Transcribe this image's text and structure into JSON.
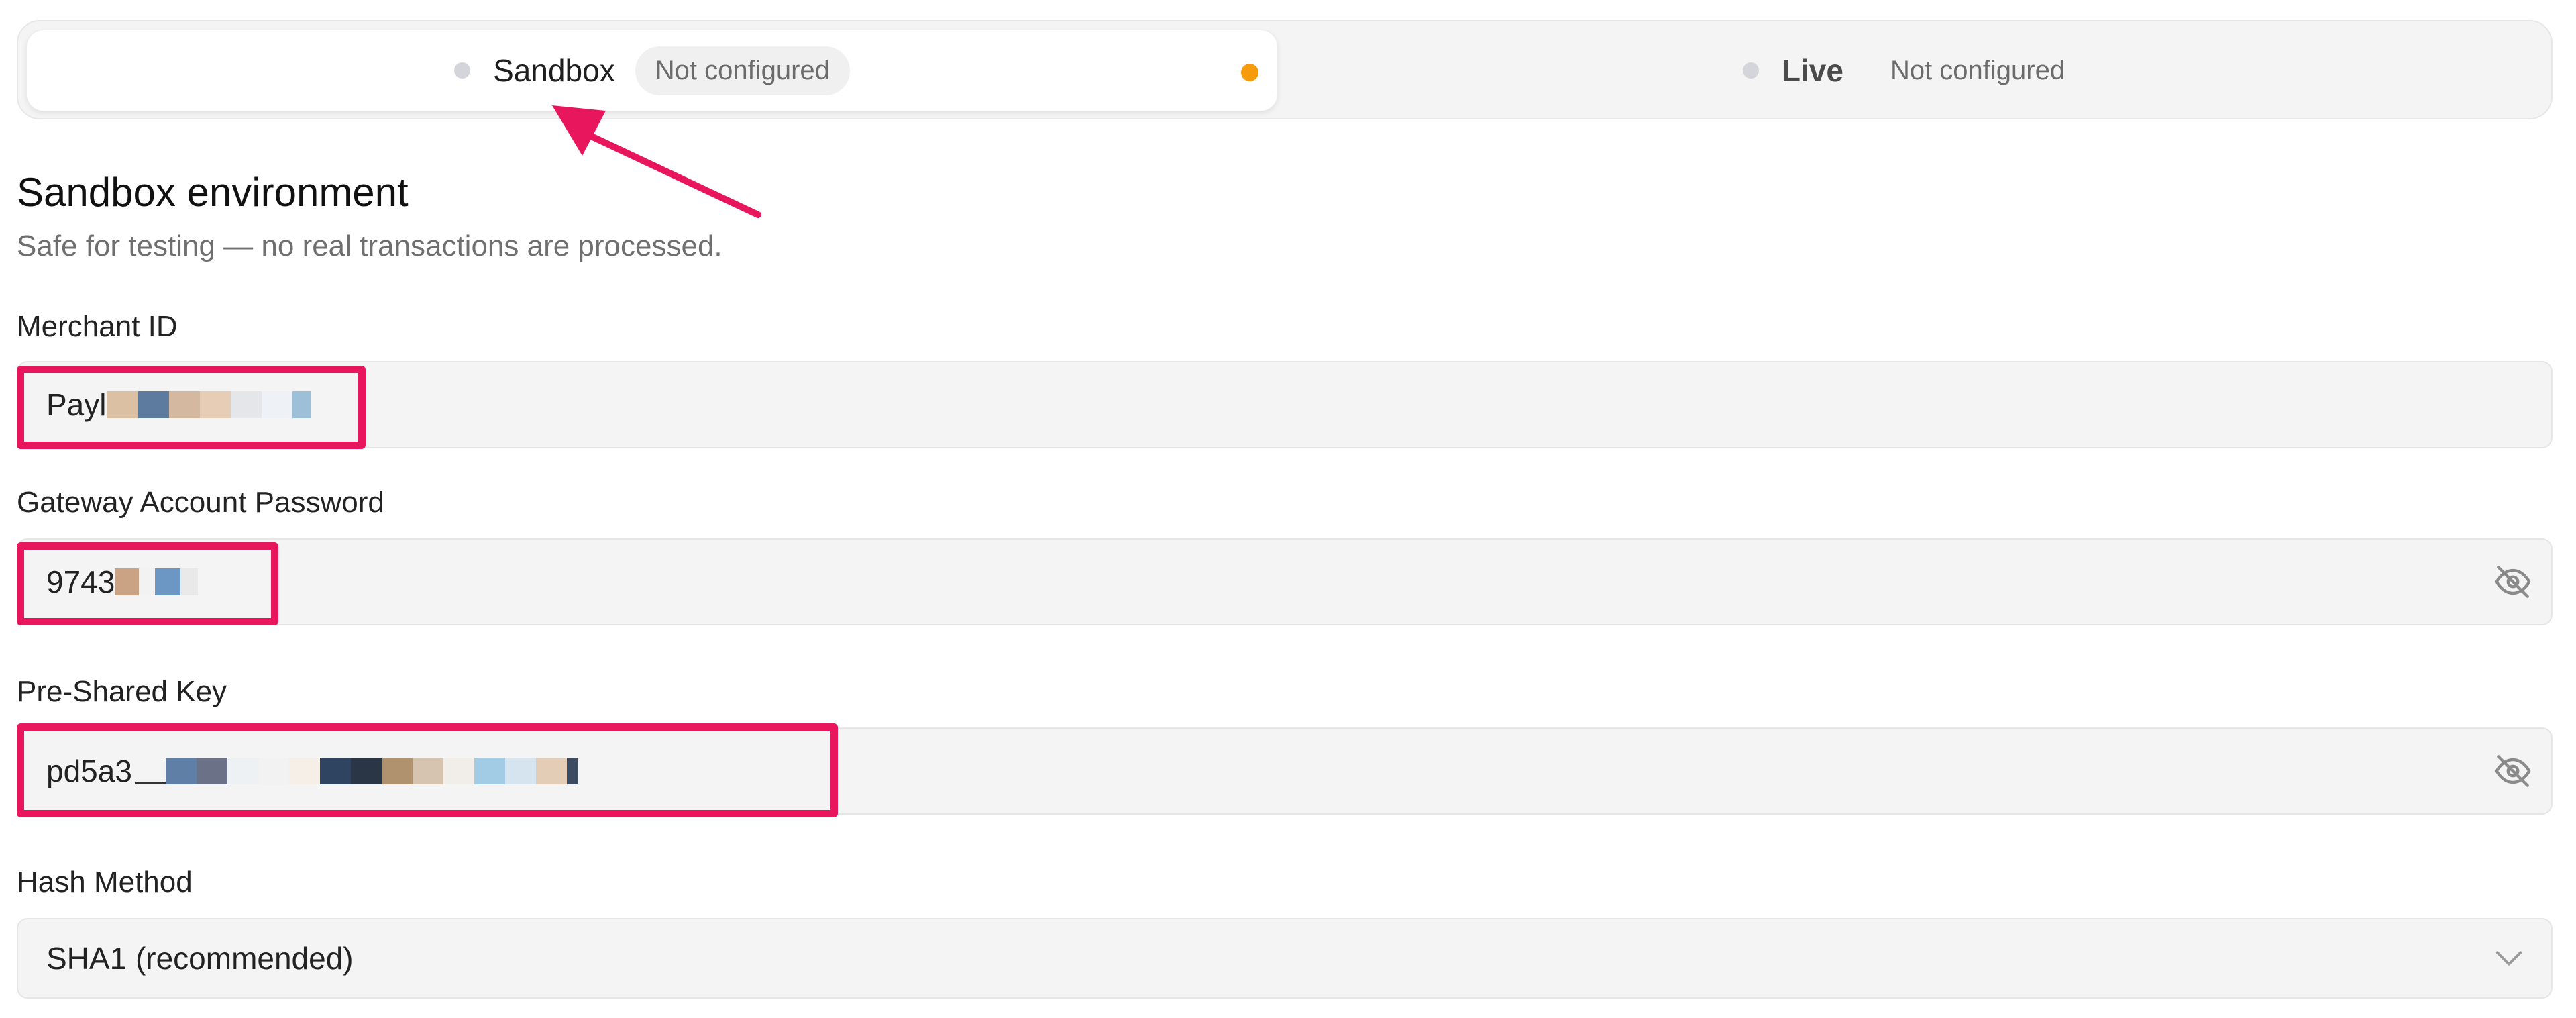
{
  "tabs": [
    {
      "label": "Sandbox",
      "badge": "Not configured",
      "active": true
    },
    {
      "label": "Live",
      "badge": "Not configured",
      "active": false
    }
  ],
  "section": {
    "title": "Sandbox environment",
    "subtitle": "Safe for testing — no real transactions are processed."
  },
  "fields": {
    "merchant_id": {
      "label": "Merchant ID",
      "visible_prefix": "Payl"
    },
    "password": {
      "label": "Gateway Account Password",
      "visible_prefix": "9743"
    },
    "psk": {
      "label": "Pre-Shared Key",
      "visible_prefix": "pd5a3"
    },
    "hash_method": {
      "label": "Hash Method",
      "selected": "SHA1 (recommended)"
    }
  },
  "colors": {
    "accent_highlight": "#e8175d",
    "status_dot": "#f59b0c",
    "field_bg": "#f4f4f4"
  },
  "icons": {
    "visibility_toggle": "eye-off-icon",
    "dropdown": "chevron-down-icon"
  }
}
